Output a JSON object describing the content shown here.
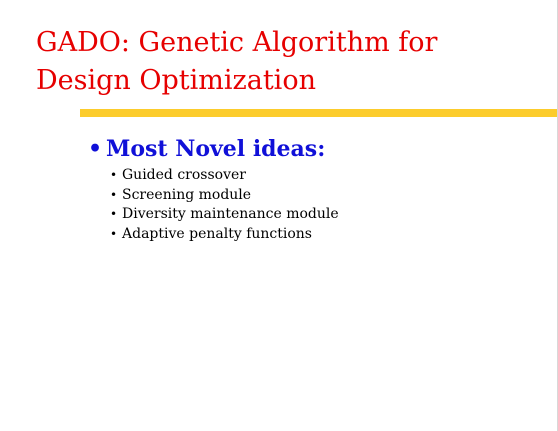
{
  "slide": {
    "title_lines": [
      "GADO: Genetic Algorithm for",
      "Design Optimization"
    ],
    "main_item": {
      "bullet": "•",
      "label": "Most Novel ideas:"
    },
    "sub_items": [
      {
        "bullet": "•",
        "label": "Guided crossover"
      },
      {
        "bullet": "•",
        "label": "Screening module"
      },
      {
        "bullet": "•",
        "label": "Diversity maintenance module"
      },
      {
        "bullet": "•",
        "label": "Adaptive penalty functions"
      }
    ]
  },
  "colors": {
    "title": "#e60000",
    "rule": "#fccc2c",
    "main_item": "#1010d8",
    "sub_items": "#000000",
    "background": "#ffffff"
  }
}
